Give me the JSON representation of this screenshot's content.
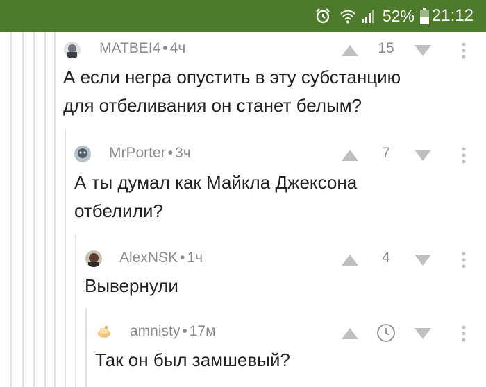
{
  "status_bar": {
    "battery_percent": "52%",
    "time": "21:12",
    "icons": [
      "alarm-icon",
      "wifi-icon",
      "signal-icon",
      "battery-icon"
    ],
    "background": "#4e7a2c"
  },
  "colors": {
    "meta": "#8b8b8b",
    "text": "#222222",
    "thread_line": "#e2e2e2",
    "vote_icon": "#bfbfbf"
  },
  "comments": [
    {
      "author": "MATBEI4",
      "time": "4ч",
      "rating": "15",
      "text": "А если негра опустить в эту субстанцию\nдля отбеливания он станет белым?"
    },
    {
      "author": "MrPorter",
      "time": "3ч",
      "rating": "7",
      "text": "А ты думал как Майкла Джексона\nотбелили?"
    },
    {
      "author": "AlexNSK",
      "time": "1ч",
      "rating": "4",
      "text": "Вывернули"
    },
    {
      "author": "amnisty",
      "time": "17м",
      "rating_icon": "clock-icon",
      "text": "Так он был замшевый?"
    }
  ]
}
